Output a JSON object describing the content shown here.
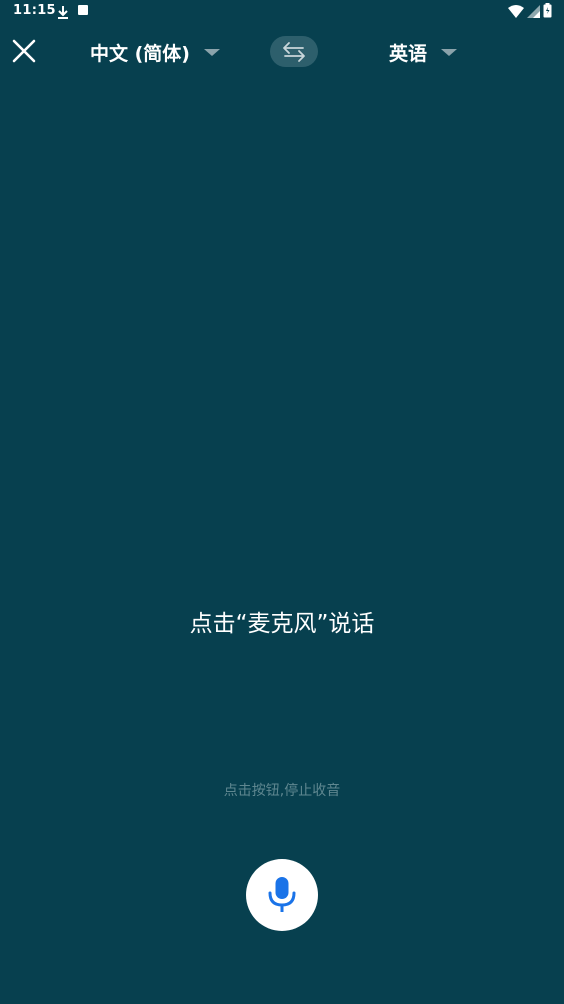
{
  "status_bar": {
    "time": "11:15"
  },
  "header": {
    "close_icon": "close-icon",
    "source_language": "中文 (简体)",
    "swap_icon": "swap-arrows-icon",
    "target_language": "英语"
  },
  "main": {
    "prompt": "点击“麦克风”说话",
    "hint": "点击按钮,停止收音",
    "mic_icon": "microphone-icon"
  },
  "colors": {
    "background": "#07404f",
    "swap_button": "#2d5f6c",
    "mic_icon": "#1a73e8",
    "hint_text": "#5f8790"
  }
}
